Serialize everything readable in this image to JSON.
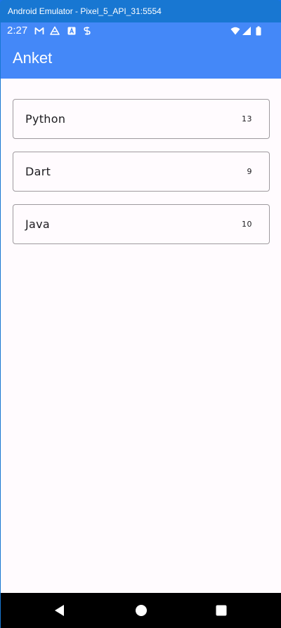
{
  "window": {
    "title": "Android Emulator - Pixel_5_API_31:5554"
  },
  "status_bar": {
    "time": "2:27",
    "left_icons": [
      "gmail-icon",
      "drive-icon",
      "app-icon",
      "s-icon"
    ],
    "right_icons": [
      "wifi-icon",
      "signal-icon",
      "battery-icon"
    ]
  },
  "app_bar": {
    "title": "Anket",
    "color": "#4488f8"
  },
  "poll_items": [
    {
      "label": "Python",
      "count": "13"
    },
    {
      "label": "Dart",
      "count": "9"
    },
    {
      "label": "Java",
      "count": "10"
    }
  ],
  "nav_bar": {
    "buttons": [
      "back-icon",
      "home-icon",
      "recents-icon"
    ]
  }
}
